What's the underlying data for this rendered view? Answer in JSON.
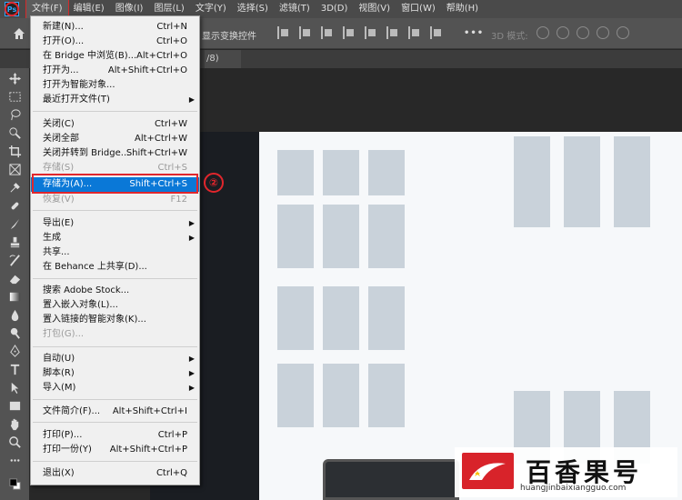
{
  "menubar": {
    "app_icon": "photoshop-icon",
    "items": [
      {
        "label": "文件(F)"
      },
      {
        "label": "编辑(E)"
      },
      {
        "label": "图像(I)"
      },
      {
        "label": "图层(L)"
      },
      {
        "label": "文字(Y)"
      },
      {
        "label": "选择(S)"
      },
      {
        "label": "滤镜(T)"
      },
      {
        "label": "3D(D)"
      },
      {
        "label": "视图(V)"
      },
      {
        "label": "窗口(W)"
      },
      {
        "label": "帮助(H)"
      }
    ]
  },
  "options_bar": {
    "show_transform": "显示变换控件",
    "more": "•••",
    "mode_3d": "3D 模式:"
  },
  "tab": {
    "label": "/8)"
  },
  "file_menu": {
    "items": [
      {
        "label": "新建(N)...",
        "shortcut": "Ctrl+N"
      },
      {
        "label": "打开(O)...",
        "shortcut": "Ctrl+O"
      },
      {
        "label": "在 Bridge 中浏览(B)...",
        "shortcut": "Alt+Ctrl+O"
      },
      {
        "label": "打开为...",
        "shortcut": "Alt+Shift+Ctrl+O"
      },
      {
        "label": "打开为智能对象...",
        "shortcut": ""
      },
      {
        "label": "最近打开文件(T)",
        "shortcut": ""
      },
      {
        "label": "关闭(C)",
        "shortcut": "Ctrl+W"
      },
      {
        "label": "关闭全部",
        "shortcut": "Alt+Ctrl+W"
      },
      {
        "label": "关闭并转到 Bridge...",
        "shortcut": "Shift+Ctrl+W"
      },
      {
        "label": "存储(S)",
        "shortcut": "Ctrl+S"
      },
      {
        "label": "存储为(A)...",
        "shortcut": "Shift+Ctrl+S"
      },
      {
        "label": "恢复(V)",
        "shortcut": "F12"
      },
      {
        "label": "导出(E)",
        "shortcut": ""
      },
      {
        "label": "生成",
        "shortcut": ""
      },
      {
        "label": "共享...",
        "shortcut": ""
      },
      {
        "label": "在 Behance 上共享(D)...",
        "shortcut": ""
      },
      {
        "label": "搜索 Adobe Stock...",
        "shortcut": ""
      },
      {
        "label": "置入嵌入对象(L)...",
        "shortcut": ""
      },
      {
        "label": "置入链接的智能对象(K)...",
        "shortcut": ""
      },
      {
        "label": "打包(G)...",
        "shortcut": ""
      },
      {
        "label": "自动(U)",
        "shortcut": ""
      },
      {
        "label": "脚本(R)",
        "shortcut": ""
      },
      {
        "label": "导入(M)",
        "shortcut": ""
      },
      {
        "label": "文件简介(F)...",
        "shortcut": "Alt+Shift+Ctrl+I"
      },
      {
        "label": "打印(P)...",
        "shortcut": "Ctrl+P"
      },
      {
        "label": "打印一份(Y)",
        "shortcut": "Alt+Shift+Ctrl+P"
      },
      {
        "label": "退出(X)",
        "shortcut": "Ctrl+Q"
      }
    ]
  },
  "annotation": {
    "step2": "②"
  },
  "watermark": {
    "title": "百香果号",
    "url": "huangjinbaixiangguo.com"
  },
  "colors": {
    "highlight": "#0a78d7",
    "annotation_red": "#e1262c",
    "menubar": "#4a4a4a"
  }
}
